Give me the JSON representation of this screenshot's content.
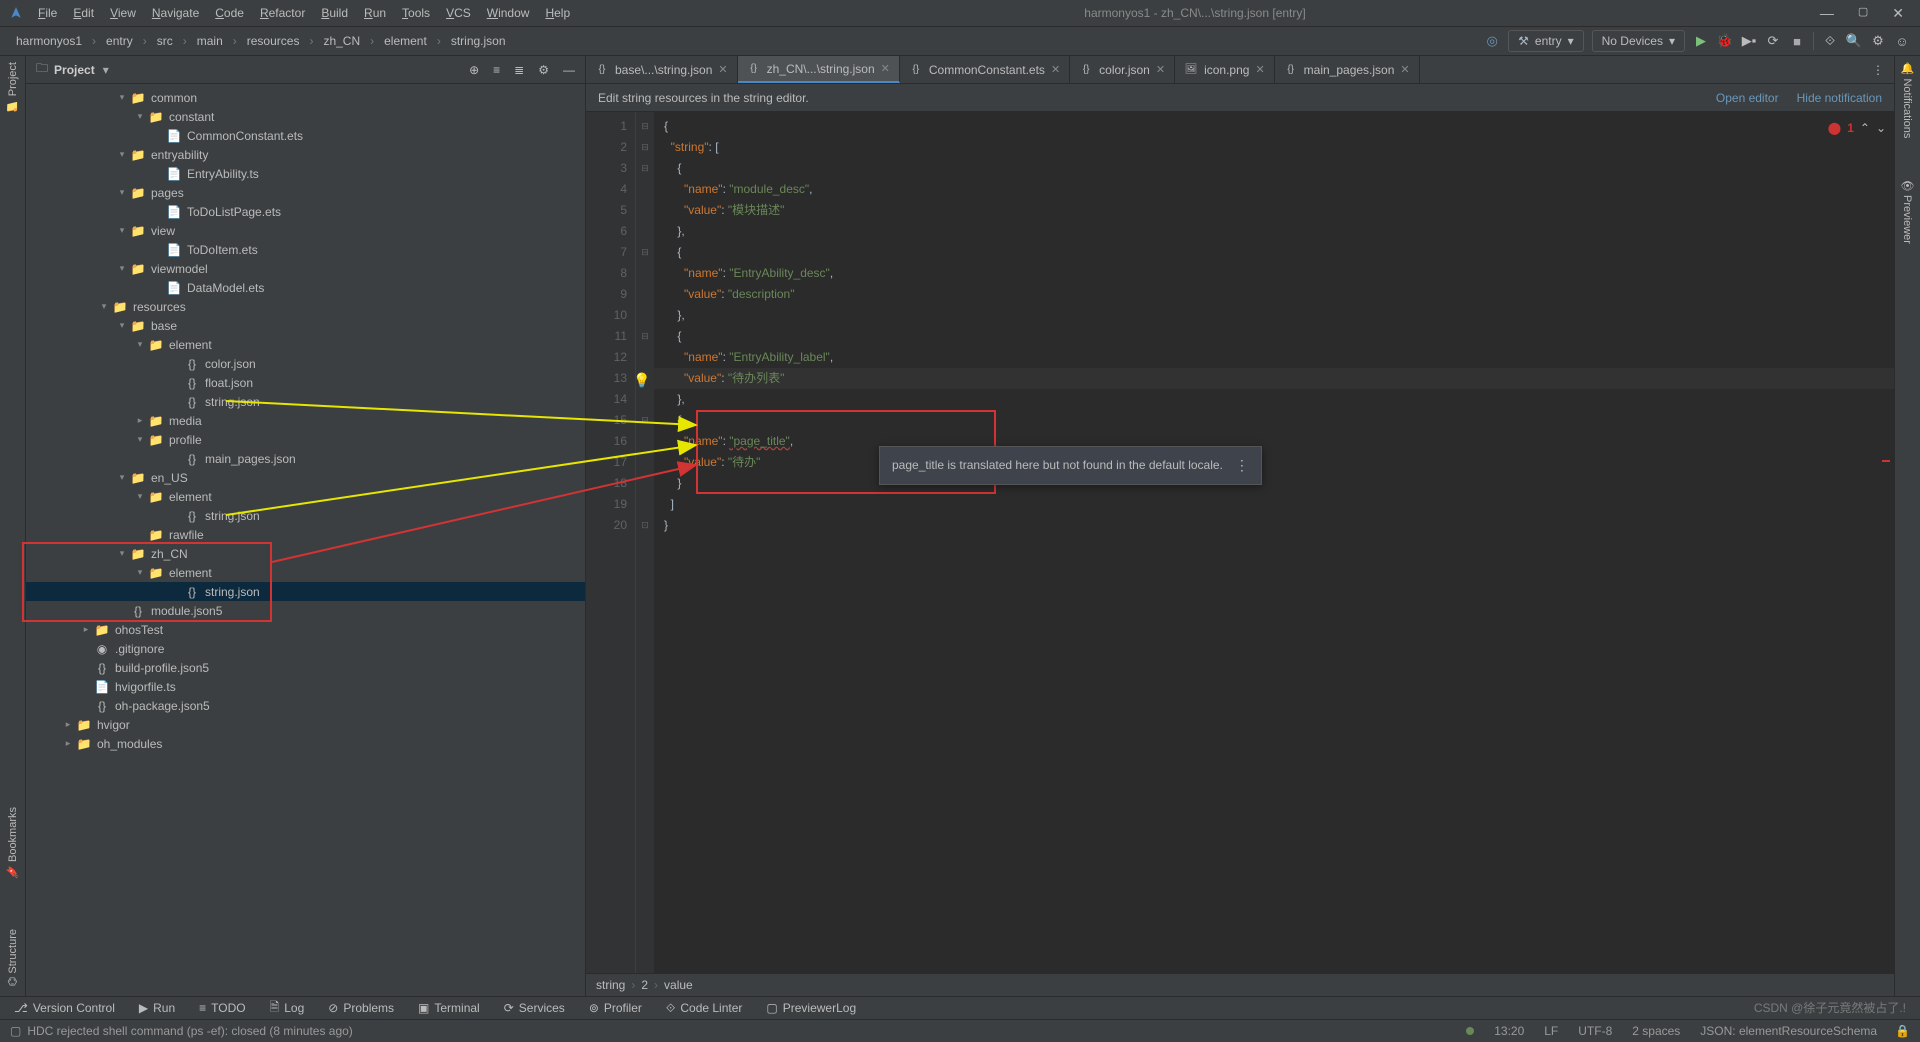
{
  "colors": {
    "yellow": "#e6e600",
    "red": "#d23333"
  },
  "title": "harmonyos1 - zh_CN\\...\\string.json [entry]",
  "menu": [
    "File",
    "Edit",
    "View",
    "Navigate",
    "Code",
    "Refactor",
    "Build",
    "Run",
    "Tools",
    "VCS",
    "Window",
    "Help"
  ],
  "breadcrumb": [
    "harmonyos1",
    "entry",
    "src",
    "main",
    "resources",
    "zh_CN",
    "element",
    "string.json"
  ],
  "run_config": {
    "module": "entry",
    "device": "No Devices"
  },
  "project_panel": {
    "title": "Project"
  },
  "tree": [
    {
      "d": 5,
      "e": "▾",
      "t": "folder",
      "n": "common"
    },
    {
      "d": 6,
      "e": "▾",
      "t": "folder",
      "n": "constant"
    },
    {
      "d": 7,
      "e": "",
      "t": "file",
      "n": "CommonConstant.ets"
    },
    {
      "d": 5,
      "e": "▾",
      "t": "folder",
      "n": "entryability"
    },
    {
      "d": 7,
      "e": "",
      "t": "file",
      "n": "EntryAbility.ts"
    },
    {
      "d": 5,
      "e": "▾",
      "t": "folder",
      "n": "pages"
    },
    {
      "d": 7,
      "e": "",
      "t": "file",
      "n": "ToDoListPage.ets"
    },
    {
      "d": 5,
      "e": "▾",
      "t": "folder",
      "n": "view"
    },
    {
      "d": 7,
      "e": "",
      "t": "file",
      "n": "ToDoItem.ets"
    },
    {
      "d": 5,
      "e": "▾",
      "t": "folder",
      "n": "viewmodel"
    },
    {
      "d": 7,
      "e": "",
      "t": "file",
      "n": "DataModel.ets"
    },
    {
      "d": 4,
      "e": "▾",
      "t": "folderr",
      "n": "resources"
    },
    {
      "d": 5,
      "e": "▾",
      "t": "folder",
      "n": "base"
    },
    {
      "d": 6,
      "e": "▾",
      "t": "folder",
      "n": "element"
    },
    {
      "d": 8,
      "e": "",
      "t": "json",
      "n": "color.json"
    },
    {
      "d": 8,
      "e": "",
      "t": "json",
      "n": "float.json"
    },
    {
      "d": 8,
      "e": "",
      "t": "json",
      "n": "string.json"
    },
    {
      "d": 6,
      "e": "▸",
      "t": "folder",
      "n": "media"
    },
    {
      "d": 6,
      "e": "▾",
      "t": "folder",
      "n": "profile"
    },
    {
      "d": 8,
      "e": "",
      "t": "json",
      "n": "main_pages.json"
    },
    {
      "d": 5,
      "e": "▾",
      "t": "folder",
      "n": "en_US"
    },
    {
      "d": 6,
      "e": "▾",
      "t": "folder",
      "n": "element"
    },
    {
      "d": 8,
      "e": "",
      "t": "json",
      "n": "string.json"
    },
    {
      "d": 6,
      "e": "",
      "t": "folder",
      "n": "rawfile"
    },
    {
      "d": 5,
      "e": "▾",
      "t": "folder",
      "n": "zh_CN"
    },
    {
      "d": 6,
      "e": "▾",
      "t": "folder",
      "n": "element"
    },
    {
      "d": 8,
      "e": "",
      "t": "json",
      "n": "string.json",
      "sel": true
    },
    {
      "d": 5,
      "e": "",
      "t": "json5",
      "n": "module.json5"
    },
    {
      "d": 3,
      "e": "▸",
      "t": "folder",
      "n": "ohosTest"
    },
    {
      "d": 3,
      "e": "",
      "t": "git",
      "n": ".gitignore"
    },
    {
      "d": 3,
      "e": "",
      "t": "json5",
      "n": "build-profile.json5"
    },
    {
      "d": 3,
      "e": "",
      "t": "file",
      "n": "hvigorfile.ts"
    },
    {
      "d": 3,
      "e": "",
      "t": "json5",
      "n": "oh-package.json5"
    },
    {
      "d": 2,
      "e": "▸",
      "t": "folder",
      "n": "hvigor"
    },
    {
      "d": 2,
      "e": "▸",
      "t": "folderr",
      "n": "oh_modules"
    }
  ],
  "tabs": [
    {
      "label": "base\\...\\string.json",
      "icon": "json"
    },
    {
      "label": "zh_CN\\...\\string.json",
      "icon": "json",
      "active": true
    },
    {
      "label": "CommonConstant.ets",
      "icon": "ets"
    },
    {
      "label": "color.json",
      "icon": "json"
    },
    {
      "label": "icon.png",
      "icon": "img"
    },
    {
      "label": "main_pages.json",
      "icon": "json"
    }
  ],
  "info_bar": {
    "text": "Edit string resources in the string editor.",
    "open": "Open editor",
    "hide": "Hide notification"
  },
  "errors": {
    "count": "1"
  },
  "code_lines": [
    "{",
    "  \"string\": [",
    "    {",
    "      \"name\": \"module_desc\",",
    "      \"value\": \"模块描述\"",
    "    },",
    "    {",
    "      \"name\": \"EntryAbility_desc\",",
    "      \"value\": \"description\"",
    "    },",
    "    {",
    "      \"name\": \"EntryAbility_label\",",
    "      \"value\": \"待办列表\"",
    "    },",
    "    {",
    "      \"name\": \"page_title\",",
    "      \"value\": \"待办\"",
    "    }",
    "  ]",
    "}"
  ],
  "tooltip": "page_title is translated here but not found in the default locale.",
  "crumb2": [
    "string",
    "2",
    "value"
  ],
  "bottombar": [
    {
      "icon": "⎇",
      "label": "Version Control"
    },
    {
      "icon": "▶",
      "label": "Run"
    },
    {
      "icon": "≡",
      "label": "TODO"
    },
    {
      "icon": "🗎",
      "label": "Log"
    },
    {
      "icon": "⊘",
      "label": "Problems"
    },
    {
      "icon": "▣",
      "label": "Terminal"
    },
    {
      "icon": "⟳",
      "label": "Services"
    },
    {
      "icon": "⊚",
      "label": "Profiler"
    },
    {
      "icon": "⟐",
      "label": "Code Linter"
    },
    {
      "icon": "▢",
      "label": "PreviewerLog"
    }
  ],
  "status": {
    "msg": "HDC rejected shell command (ps -ef): closed (8 minutes ago)",
    "pos": "13:20",
    "eol": "LF",
    "enc": "UTF-8",
    "indent": "2 spaces",
    "schema": "JSON: elementResourceSchema",
    "watermark": "CSDN @徐子元竟然被占了.!"
  }
}
